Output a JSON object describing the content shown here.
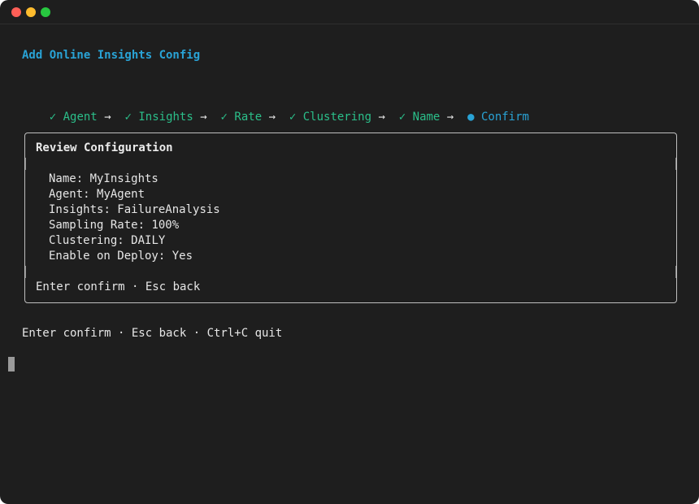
{
  "window": {
    "controls": [
      "close",
      "minimize",
      "maximize"
    ]
  },
  "heading": "Add Online Insights Config",
  "steps": [
    {
      "mark": "✓",
      "label": "Agent",
      "status": "done"
    },
    {
      "mark": "✓",
      "label": "Insights",
      "status": "done"
    },
    {
      "mark": "✓",
      "label": "Rate",
      "status": "done"
    },
    {
      "mark": "✓",
      "label": "Clustering",
      "status": "done"
    },
    {
      "mark": "✓",
      "label": "Name",
      "status": "done"
    },
    {
      "mark": "●",
      "label": "Confirm",
      "status": "current"
    }
  ],
  "step_separator": "→",
  "review": {
    "title": "Review Configuration",
    "fields": [
      {
        "label": "Name",
        "value": "MyInsights"
      },
      {
        "label": "Agent",
        "value": "MyAgent"
      },
      {
        "label": "Insights",
        "value": "FailureAnalysis"
      },
      {
        "label": "Sampling Rate",
        "value": "100%"
      },
      {
        "label": "Clustering",
        "value": "DAILY"
      },
      {
        "label": "Enable on Deploy",
        "value": "Yes"
      }
    ],
    "help": "Enter confirm · Esc back"
  },
  "footer": "Enter confirm · Esc back · Ctrl+C quit",
  "colors": {
    "background": "#1e1e1e",
    "accent": "#29a3d6",
    "done": "#2bbf8a",
    "text": "#e6e6e6",
    "border": "#bfbfbf"
  }
}
